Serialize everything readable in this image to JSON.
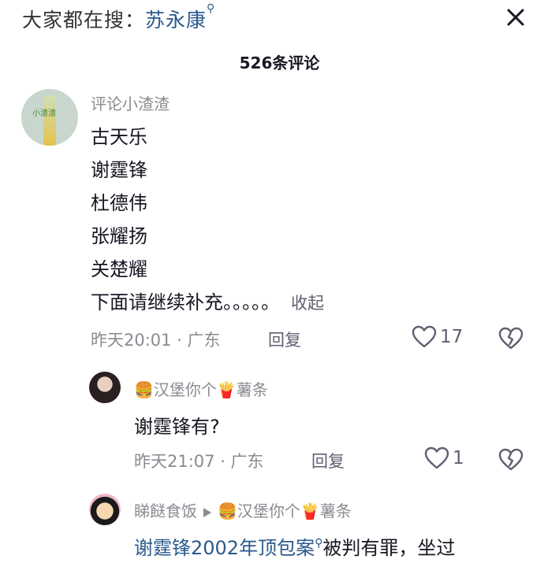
{
  "header": {
    "search_prefix": "大家都在搜：",
    "search_term": "苏永康",
    "search_mark": "⚲"
  },
  "comments_title": "526条评论",
  "comment": {
    "username": "评论小渣渣",
    "avatar_text": "小渣渣",
    "lines": [
      "古天乐",
      "谢霆锋",
      "杜德伟",
      "张耀扬",
      "关楚耀",
      "下面请继续补充。。。。。"
    ],
    "collapse_label": "收起",
    "time_location": "昨天20:01 · 广东",
    "reply_label": "回复",
    "like_count": "17"
  },
  "reply1": {
    "username_emoji_left": "🍔",
    "username": "汉堡你个",
    "username_emoji_right": "🍟",
    "username_tail": "薯条",
    "text": "谢霆锋有?",
    "time_location": "昨天21:07 · 广东",
    "reply_label": "回复",
    "like_count": "1"
  },
  "reply2": {
    "username": "睇餸食饭",
    "target_emoji_left": "🍔",
    "target_username": "汉堡你个",
    "target_emoji_right": "🍟",
    "target_tail": "薯条",
    "linked_text": "谢霆锋2002年顶包案",
    "text_rest": "被判有罪，坐过"
  },
  "colors": {
    "link_blue": "#2a5a8c",
    "meta_gray": "#8a8b91",
    "text_dark": "#161823"
  }
}
